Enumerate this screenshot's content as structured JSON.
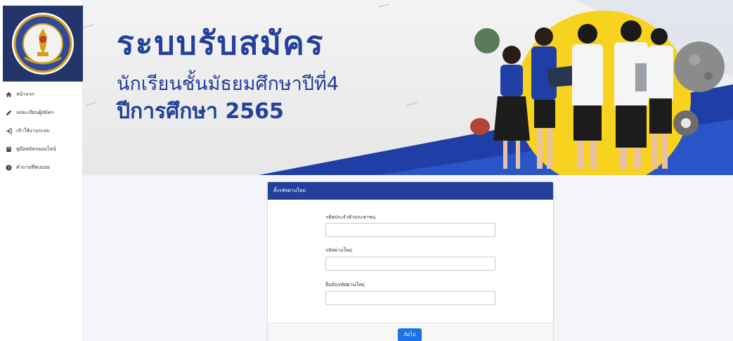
{
  "sidebar": {
    "logo_icon": "school-seal-logo",
    "items": [
      {
        "label": "หน้าแรก",
        "icon": "home-icon"
      },
      {
        "label": "ลงทะเบียนผู้สมัคร",
        "icon": "pencil-icon"
      },
      {
        "label": "เข้าใช้งานระบบ",
        "icon": "sign-in-icon"
      },
      {
        "label": "คู่มือสมัครออนไลน์",
        "icon": "book-icon"
      },
      {
        "label": "คำถามที่พบบ่อย",
        "icon": "question-circle-icon"
      }
    ]
  },
  "banner": {
    "title": "ระบบรับสมัคร",
    "subtitle_line1": "นักเรียนชั้นมัธยมศึกษาปีที่4",
    "subtitle_line2": "ปีการศึกษา 2565"
  },
  "form": {
    "header": "ตั้งรหัสผ่านใหม่",
    "fields": [
      {
        "label": "รหัสประจำตัวประชาชน",
        "value": "",
        "placeholder": ""
      },
      {
        "label": "รหัสผ่านใหม่",
        "value": "",
        "placeholder": ""
      },
      {
        "label": "ยืนยันรหัสผ่านใหม่",
        "value": "",
        "placeholder": ""
      }
    ],
    "submit_label": "ถัดไป"
  },
  "colors": {
    "primary": "#23409b",
    "logo_bg": "#23356b",
    "button": "#1a73e8",
    "background": "#f4f5fa"
  }
}
